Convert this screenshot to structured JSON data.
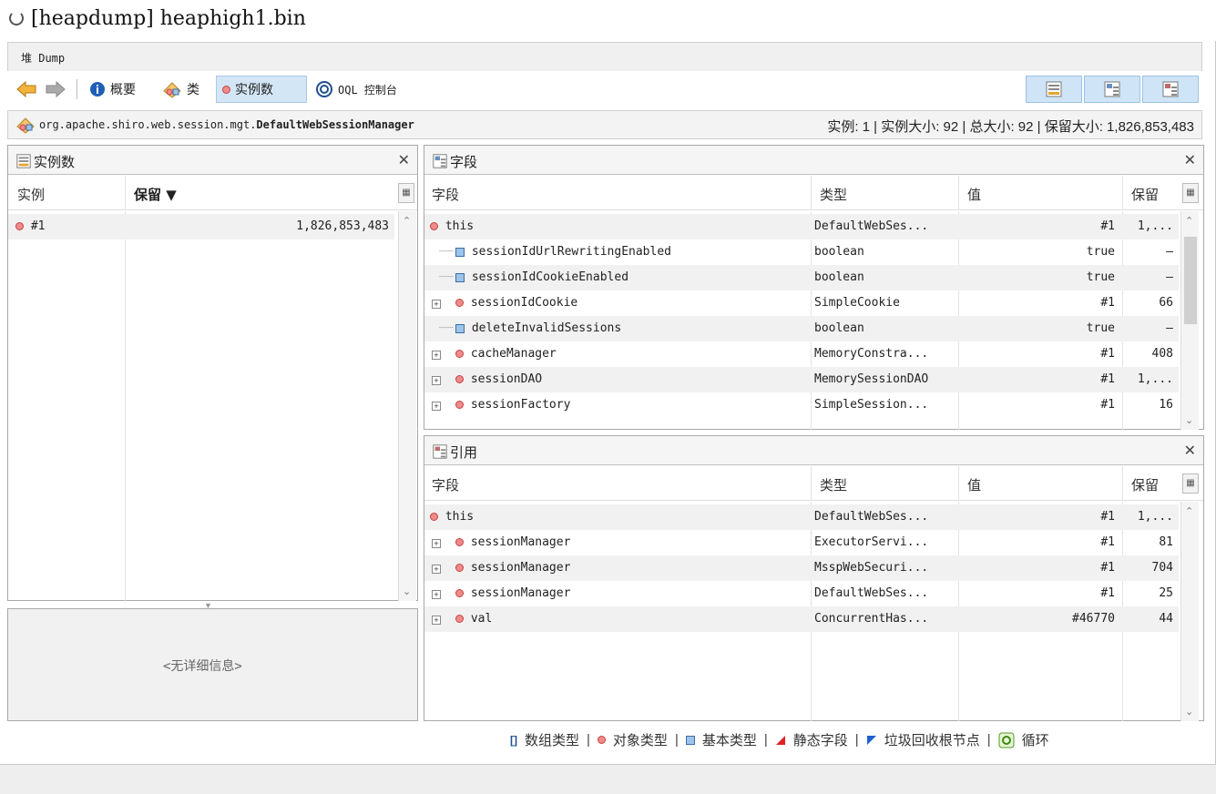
{
  "window": {
    "title": "[heapdump] heaphigh1.bin"
  },
  "heap_tab": {
    "label": "堆 Dump"
  },
  "toolbar": {
    "summary_label": "概要",
    "classes_label": "类",
    "instances_label": "实例数",
    "oql_label": "OQL 控制台"
  },
  "classbar": {
    "path_prefix": "org.apache.shiro.web.session.mgt.",
    "class_name": "DefaultWebSessionManager",
    "stats": "实例: 1  |  实例大小: 92  |  总大小: 92  |  保留大小: 1,826,853,483"
  },
  "instances_panel": {
    "title": "实例数",
    "col_instance": "实例",
    "col_retained": "保留 ▼",
    "rows": [
      {
        "id": "#1",
        "retained": "1,826,853,483"
      }
    ],
    "no_details": "<无详细信息>"
  },
  "fields_panel": {
    "title": "字段",
    "cols": {
      "field": "字段",
      "type": "类型",
      "value": "值",
      "retained": "保留"
    },
    "rows": [
      {
        "name": "this",
        "type": "DefaultWebSes...",
        "value": "#1",
        "retained": "1,..."
      },
      {
        "name": "sessionIdUrlRewritingEnabled",
        "type": "boolean",
        "value": "true",
        "retained": "–"
      },
      {
        "name": "sessionIdCookieEnabled",
        "type": "boolean",
        "value": "true",
        "retained": "–"
      },
      {
        "name": "sessionIdCookie",
        "type": "SimpleCookie",
        "value": "#1",
        "retained": "66"
      },
      {
        "name": "deleteInvalidSessions",
        "type": "boolean",
        "value": "true",
        "retained": "–"
      },
      {
        "name": "cacheManager",
        "type": "MemoryConstra...",
        "value": "#1",
        "retained": "408"
      },
      {
        "name": "sessionDAO",
        "type": "MemorySessionDAO",
        "value": "#1",
        "retained": "1,..."
      },
      {
        "name": "sessionFactory",
        "type": "SimpleSession...",
        "value": "#1",
        "retained": "16"
      }
    ]
  },
  "refs_panel": {
    "title": "引用",
    "cols": {
      "field": "字段",
      "type": "类型",
      "value": "值",
      "retained": "保留"
    },
    "rows": [
      {
        "name": "this",
        "type": "DefaultWebSes...",
        "value": "#1",
        "retained": "1,..."
      },
      {
        "name": "sessionManager",
        "type": "ExecutorServi...",
        "value": "#1",
        "retained": "81"
      },
      {
        "name": "sessionManager",
        "type": "MsspWebSecuri...",
        "value": "#1",
        "retained": "704"
      },
      {
        "name": "sessionManager",
        "type": "DefaultWebSes...",
        "value": "#1",
        "retained": "25"
      },
      {
        "name": "val",
        "type": "ConcurrentHas...",
        "value": "#46770",
        "retained": "44"
      }
    ]
  },
  "legend": {
    "array_type": "数组类型",
    "object_type": "对象类型",
    "primitive_type": "基本类型",
    "static_field": "静态字段",
    "gc_root": "垃圾回收根节点",
    "loop": "循环"
  }
}
